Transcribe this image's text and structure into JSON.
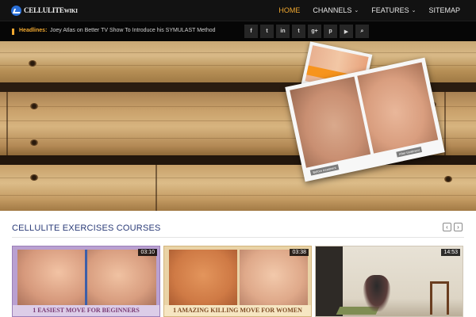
{
  "brand": {
    "name": "CELLULITE",
    "suffix": "WIKI"
  },
  "nav": {
    "items": [
      {
        "label": "HOME",
        "active": true,
        "dropdown": false
      },
      {
        "label": "CHANNELS",
        "active": false,
        "dropdown": true
      },
      {
        "label": "FEATURES",
        "active": false,
        "dropdown": true
      },
      {
        "label": "SITEMAP",
        "active": false,
        "dropdown": false
      }
    ],
    "accent_color": "#f0a830"
  },
  "ticker": {
    "label": "Headlines:",
    "text": "Joey Atlas on Better TV Show To Introduce his SYMULAST Method"
  },
  "social": [
    {
      "icon": "facebook-icon",
      "glyph": "f"
    },
    {
      "icon": "twitter-icon",
      "glyph": "t"
    },
    {
      "icon": "linkedin-icon",
      "glyph": "in"
    },
    {
      "icon": "tumblr-icon",
      "glyph": "t"
    },
    {
      "icon": "google-plus-icon",
      "glyph": "g+"
    },
    {
      "icon": "pinterest-icon",
      "glyph": "p"
    },
    {
      "icon": "youtube-icon",
      "glyph": "▶"
    },
    {
      "icon": "search-icon",
      "glyph": "⌕"
    }
  ],
  "hero": {
    "before_label": "Before treatment",
    "after_label": "After treatment"
  },
  "section": {
    "title": "CELLULITE EXERCISES COURSES",
    "prev": "‹",
    "next": "›"
  },
  "videos": [
    {
      "duration": "03:10",
      "title": "1 EASIEST MOVE FOR BEGINNERS"
    },
    {
      "duration": "03:38",
      "title": "1 AMAZING KILLING MOVE FOR WOMEN"
    },
    {
      "duration": "14:53",
      "title": ""
    }
  ]
}
